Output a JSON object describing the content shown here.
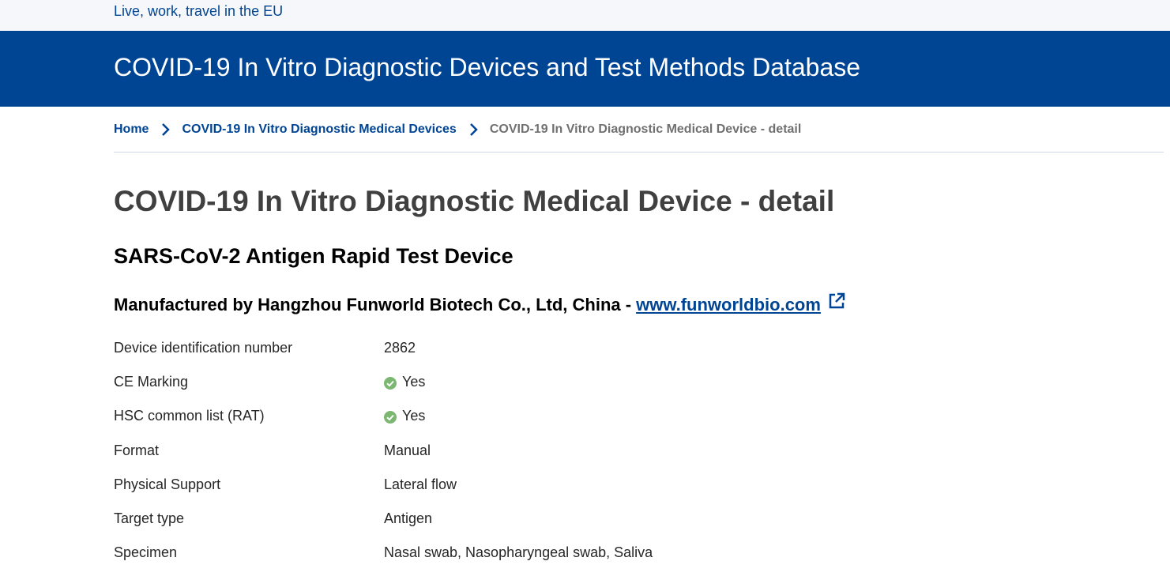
{
  "topbar": {
    "link": "Live, work, travel in the EU"
  },
  "banner": {
    "title": "COVID-19 In Vitro Diagnostic Devices and Test Methods Database"
  },
  "breadcrumb": {
    "items": [
      {
        "label": "Home"
      },
      {
        "label": "COVID-19 In Vitro Diagnostic Medical Devices"
      },
      {
        "label": "COVID-19 In Vitro Diagnostic Medical Device - detail"
      }
    ]
  },
  "page": {
    "title": "COVID-19 In Vitro Diagnostic Medical Device - detail",
    "device_name": "SARS-CoV-2 Antigen Rapid Test Device",
    "manufacturer_prefix": "Manufactured by Hangzhou Funworld Biotech Co., Ltd, China -",
    "manufacturer_link": "www.funworldbio.com"
  },
  "details": [
    {
      "label": "Device identification number",
      "value": "2862",
      "check": false
    },
    {
      "label": "CE Marking",
      "value": "Yes",
      "check": true
    },
    {
      "label": "HSC common list (RAT)",
      "value": "Yes",
      "check": true
    },
    {
      "label": "Format",
      "value": "Manual",
      "check": false
    },
    {
      "label": "Physical Support",
      "value": "Lateral flow",
      "check": false
    },
    {
      "label": "Target type",
      "value": "Antigen",
      "check": false
    },
    {
      "label": "Specimen",
      "value": "Nasal swab, Nasopharyngeal swab, Saliva",
      "check": false
    }
  ],
  "icons": {
    "breadcrumb_separator": "chevron-right-icon",
    "external_link": "external-link-icon",
    "check": "check-circle-icon"
  },
  "colors": {
    "brand_blue": "#004494",
    "check_green": "#7cb772",
    "muted_text": "#707070"
  }
}
